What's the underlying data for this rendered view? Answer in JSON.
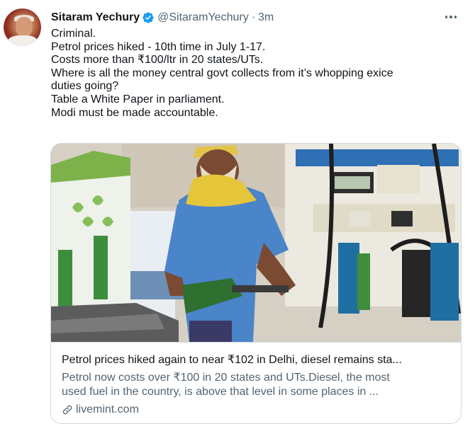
{
  "author": {
    "name": "Sitaram Yechury",
    "handle": "@SitaramYechury",
    "separator": "·",
    "time": "3m",
    "verified": true
  },
  "tweet": {
    "lines": [
      "Criminal.",
      "Petrol prices hiked - 10th time in July 1-17.",
      "Costs more than ₹100/ltr in 20 states/UTs.",
      "Where is all the money central govt collects from it’s whopping exice",
      "duties going?",
      "Table a White Paper in parliament.",
      "Modi must be made accountable."
    ]
  },
  "card": {
    "title": "Petrol prices hiked again to near ₹102 in Delhi, diesel remains sta...",
    "description_line1": "Petrol now costs over ₹100 in 20 states and UTs.Diesel, the most",
    "description_line2": "used fuel in the country, is above that level in some places in ...",
    "domain": "livemint.com",
    "image_icon": "fuel-station-photo"
  },
  "colors": {
    "accent": "#1d9bf0",
    "text_primary": "#0f1419",
    "text_secondary": "#536471",
    "border": "#cfd9de"
  }
}
